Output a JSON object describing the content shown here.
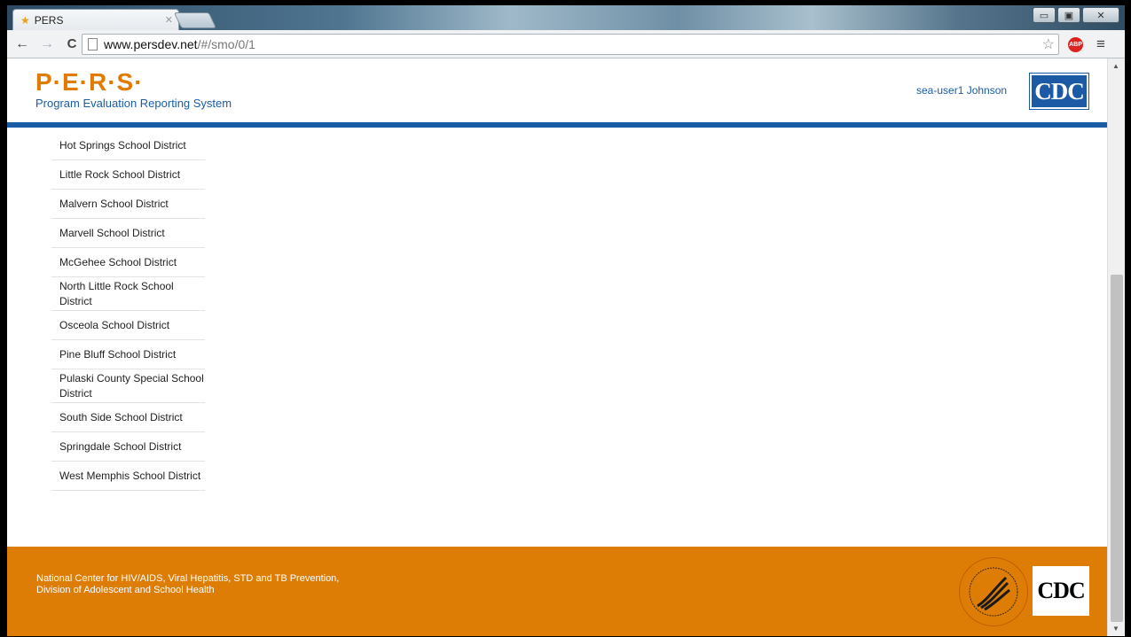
{
  "browser": {
    "tab_title": "PERS",
    "url_host": "www.persdev.net",
    "url_path": "/#/smo/0/1",
    "buttons": {
      "back": "←",
      "forward": "→",
      "reload": "C",
      "minimize": "▭",
      "maximize": "▣",
      "close": "✕",
      "bookmark": "☆",
      "adblock": "ABP",
      "menu": "≡"
    }
  },
  "header": {
    "logo": "P·E·R·S·",
    "subtitle": "Program Evaluation Reporting System",
    "user_name": "sea-user1 Johnson",
    "cdc_logo": "CDC"
  },
  "districts": [
    "Hot Springs School District",
    "Little Rock School District",
    "Malvern School District",
    "Marvell School District",
    "McGehee School District",
    "North Little Rock School District",
    "Osceola School District",
    "Pine Bluff School District",
    "Pulaski County Special School District",
    "South Side School District",
    "Springdale School District",
    "West Memphis School District"
  ],
  "footer": {
    "line1": "National Center for HIV/AIDS, Viral Hepatitis, STD and TB Prevention,",
    "line2": "Division of Adolescent and School Health",
    "cdc_logo": "CDC"
  },
  "colors": {
    "brand_orange": "#de7d05",
    "brand_blue": "#1a5da6"
  },
  "icons": [
    "favicon-star-icon",
    "page-icon",
    "star-icon",
    "adblock-icon",
    "menu-icon",
    "hhs-seal-icon"
  ]
}
